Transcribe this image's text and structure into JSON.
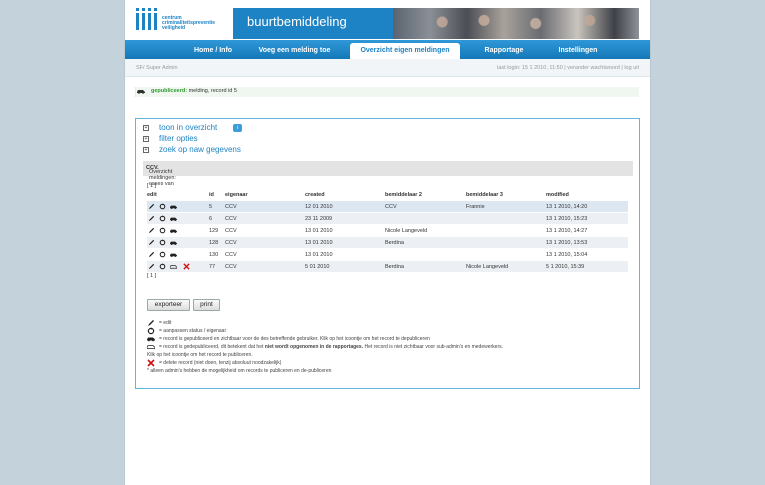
{
  "header": {
    "logo_line1": "centrum",
    "logo_line2": "criminaliteitspreventie",
    "logo_line3": "veiligheid",
    "title": "buurtbemiddeling"
  },
  "nav": [
    {
      "label": "Home / Info",
      "active": false
    },
    {
      "label": "Voeg een melding toe",
      "active": false
    },
    {
      "label": "Overzicht eigen meldingen",
      "active": true
    },
    {
      "label": "Rapportage",
      "active": false
    },
    {
      "label": "Instellingen",
      "active": false
    }
  ],
  "subbar": {
    "user": "SF/ Super Admin",
    "session": "last login: 15 1 2010, 11:50 | verander wachtwoord | log uit"
  },
  "notice": {
    "status": "gepubliceerd:",
    "message": " melding, record id 5"
  },
  "panel": {
    "toggle1": "toon in overzicht",
    "toggle1_info": "i",
    "toggle2": "filter opties",
    "toggle3": "zoek op naw gegevens",
    "overview_prefix": "Overzicht meldingen: cases van ",
    "overview_case": "CCV.",
    "pager_top": "[ 1 ]",
    "pager_bottom": "[ 1 ]"
  },
  "table": {
    "columns": [
      "edit",
      "id",
      "eigenaar",
      "created",
      "bemiddelaar 2",
      "bemiddelaar 3",
      "modified"
    ],
    "rows": [
      [
        "5",
        "CCV",
        "12 01 2010",
        "CCV",
        "Frannie",
        "13 1 2010, 14:20"
      ],
      [
        "6",
        "CCV",
        "23 11 2009",
        "",
        "",
        "13 1 2010, 15:23"
      ],
      [
        "129",
        "CCV",
        "13 01 2010",
        "Nicole Langeveld",
        "",
        "13 1 2010, 14:27"
      ],
      [
        "128",
        "CCV",
        "13 01 2010",
        "Berdina",
        "",
        "13 1 2010, 13:53"
      ],
      [
        "130",
        "CCV",
        "13 01 2010",
        "",
        "",
        "13 1 2010, 15:04"
      ],
      [
        "77",
        "CCV",
        "5 01 2010",
        "Berdina",
        "Nicole Langeveld",
        "5 1 2010, 15:39"
      ]
    ]
  },
  "buttons": {
    "export": "exporteer",
    "print": "print"
  },
  "legend": {
    "edit": "= edit",
    "status": "= aanpassen status / eigenaar",
    "published": "= record is gepubliceerd en zichtbaar voor de des betreffende gebruiker. Klik op het icoontje om het record te depubliceren",
    "unpublished_a": "= record is gedepubliceerd, dit betekent dat het ",
    "unpublished_b": "niet wordt opgenomen in de rapportages.",
    "unpublished_c": " Het record is niet zichtbaar voor sub-admin's en medewerkers.",
    "unpublished_d": "Klik op het icoontje om het record te publiceren.",
    "delete": "= delete record (niet doen, tenzij absoluut noodzakelijk)",
    "note": "* alleen admin's hebben de mogelijkheid om records te publiceren en de-publiceren"
  },
  "colors": {
    "brand": "#1e83c4",
    "nav_gradient_top": "#2f98d8",
    "published_green": "#2e9a2e",
    "delete_red": "#cc1111",
    "panel_border": "#62b3dd"
  },
  "icons": [
    "edit-pencil-icon",
    "status-cycle-icon",
    "published-car-icon",
    "unpublished-car-icon",
    "delete-x-icon",
    "expand-plus-icon",
    "info-icon"
  ]
}
